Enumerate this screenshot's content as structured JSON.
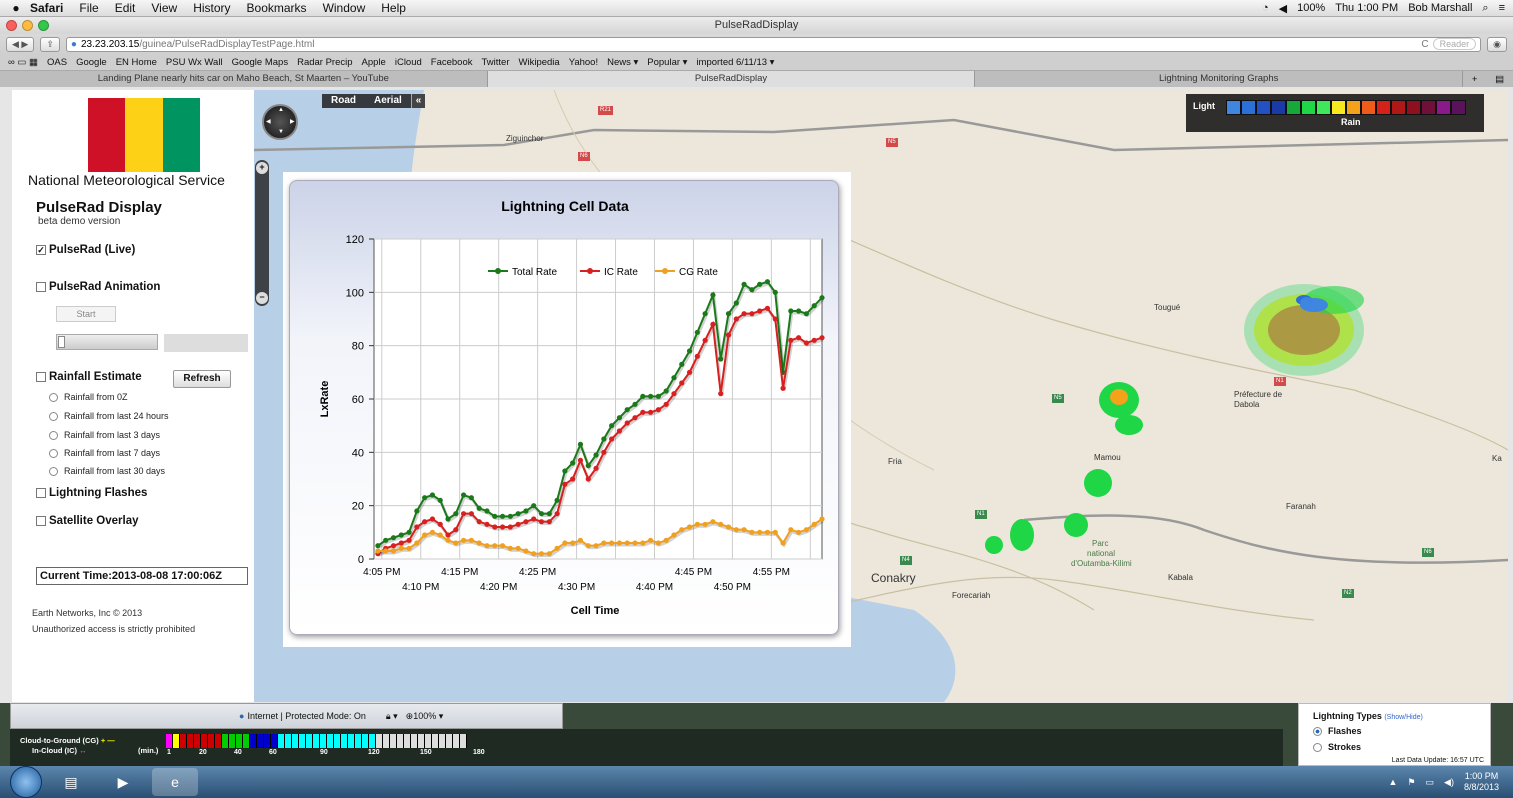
{
  "macmenu": {
    "apple": "",
    "items": [
      "Safari",
      "File",
      "Edit",
      "View",
      "History",
      "Bookmarks",
      "Window",
      "Help"
    ],
    "battery": "100%",
    "clock": "Thu 1:00 PM",
    "user": "Bob Marshall"
  },
  "browser": {
    "window_title": "PulseRadDisplay",
    "url_host": "23.23.203.15",
    "url_path": "/guinea/PulseRadDisplayTestPage.html",
    "reader": "Reader",
    "bookmarks": [
      "OAS",
      "Google",
      "EN Home",
      "PSU Wx Wall",
      "Google Maps",
      "Radar Precip",
      "Apple",
      "iCloud",
      "Facebook",
      "Twitter",
      "Wikipedia",
      "Yahoo!",
      "News ▾",
      "Popular ▾",
      "imported 6/11/13 ▾"
    ],
    "tabs": [
      "Landing Plane nearly hits car on Maho Beach, St Maarten – YouTube",
      "PulseRadDisplay",
      "Lightning Monitoring Graphs"
    ]
  },
  "sidebar": {
    "org": "National Meteorological Service",
    "title": "PulseRad Display",
    "subtitle": "beta demo version",
    "live_label": "PulseRad (Live)",
    "animation_label": "PulseRad Animation",
    "start_label": "Start",
    "rainfall_label": "Rainfall Estimate",
    "refresh_label": "Refresh",
    "rain_options": [
      "Rainfall from 0Z",
      "Rainfall from last 24 hours",
      "Rainfall from last 3 days",
      "Rainfall from last 7 days",
      "Rainfall from last 30 days"
    ],
    "lightning_label": "Lightning Flashes",
    "satellite_label": "Satellite Overlay",
    "current_time": "Current Time:2013-08-08 17:00:06Z",
    "copyright": "Earth Networks, Inc © 2013",
    "warning": "Unauthorized access is strictly prohibited",
    "flag_colors": [
      "#ce1126",
      "#fcd116",
      "#009460"
    ]
  },
  "map": {
    "road_label": "Road",
    "aerial_label": "Aerial",
    "collapse": "«",
    "legend_light": "Light",
    "legend_rain": "Rain",
    "legend_colors": [
      "#3f86e0",
      "#2b6fd8",
      "#2350c2",
      "#1a3aa8",
      "#17a83a",
      "#1ed646",
      "#3fe85a",
      "#f7e81f",
      "#f4a21a",
      "#ef5b18",
      "#d6201a",
      "#b01818",
      "#8c1020",
      "#701038",
      "#8a1a8a",
      "#5a125a"
    ],
    "places": [
      "Ziguinchor",
      "Tougué",
      "Préfecture de",
      "Dabola",
      "Mamou",
      "Fria",
      "Faranah",
      "Conakry",
      "Forecariah",
      "Kabala",
      "Parc",
      "national",
      "d'Outamba-Kilimi",
      "Ka"
    ],
    "roads": [
      "R21",
      "N6",
      "N5",
      "N5",
      "N1",
      "N1",
      "N4",
      "N6",
      "N2"
    ]
  },
  "chart_data": {
    "type": "line",
    "title": "Lightning Cell Data",
    "xlabel": "Cell Time",
    "ylabel": "LxRate",
    "ylim": [
      0,
      120
    ],
    "yticks": [
      0,
      20,
      40,
      60,
      80,
      100,
      120
    ],
    "xlim": [
      4.0,
      61.5
    ],
    "xticks_upper": [
      {
        "x": 5,
        "label": "4:05 PM"
      },
      {
        "x": 15,
        "label": "4:15 PM"
      },
      {
        "x": 25,
        "label": "4:25 PM"
      },
      {
        "x": 45,
        "label": "4:45 PM"
      },
      {
        "x": 55,
        "label": "4:55 PM"
      }
    ],
    "xticks_lower": [
      {
        "x": 10,
        "label": "4:10 PM"
      },
      {
        "x": 20,
        "label": "4:20 PM"
      },
      {
        "x": 30,
        "label": "4:30 PM"
      },
      {
        "x": 40,
        "label": "4:40 PM"
      },
      {
        "x": 50,
        "label": "4:50 PM"
      }
    ],
    "grid": true,
    "legend_placement": "top-right",
    "x": [
      4.5,
      5.5,
      6.5,
      7.5,
      8.5,
      9.5,
      10.5,
      11.5,
      12.5,
      13.5,
      14.5,
      15.5,
      16.5,
      17.5,
      18.5,
      19.5,
      20.5,
      21.5,
      22.5,
      23.5,
      24.5,
      25.5,
      26.5,
      27.5,
      28.5,
      29.5,
      30.5,
      31.5,
      32.5,
      33.5,
      34.5,
      35.5,
      36.5,
      37.5,
      38.5,
      39.5,
      40.5,
      41.5,
      42.5,
      43.5,
      44.5,
      45.5,
      46.5,
      47.5,
      48.5,
      49.5,
      50.5,
      51.5,
      52.5,
      53.5,
      54.5,
      55.5,
      56.5,
      57.5,
      58.5,
      59.5,
      60.5,
      61.5
    ],
    "series": [
      {
        "name": "Total Rate",
        "color": "#1a7a1a",
        "values": [
          5,
          7,
          8,
          9,
          10,
          18,
          23,
          24,
          22,
          15,
          17,
          24,
          23,
          19,
          18,
          16,
          16,
          16,
          17,
          18,
          20,
          17,
          17,
          22,
          33,
          36,
          43,
          35,
          39,
          45,
          50,
          53,
          56,
          58,
          61,
          61,
          61,
          63,
          68,
          73,
          78,
          85,
          92,
          99,
          75,
          92,
          96,
          103,
          101,
          103,
          104,
          100,
          70,
          93,
          93,
          92,
          95,
          98
        ]
      },
      {
        "name": "IC Rate",
        "color": "#d82020",
        "values": [
          2,
          4,
          5,
          6,
          7,
          12,
          14,
          15,
          13,
          9,
          11,
          17,
          17,
          14,
          13,
          12,
          12,
          12,
          13,
          14,
          15,
          14,
          14,
          17,
          28,
          30,
          37,
          30,
          34,
          40,
          45,
          48,
          51,
          53,
          55,
          55,
          56,
          58,
          62,
          66,
          70,
          76,
          82,
          88,
          62,
          84,
          90,
          92,
          92,
          93,
          94,
          90,
          64,
          82,
          83,
          81,
          82,
          83
        ]
      },
      {
        "name": "CG Rate",
        "color": "#f0a020",
        "values": [
          3,
          3,
          3,
          4,
          4,
          6,
          9,
          10,
          9,
          7,
          6,
          7,
          7,
          6,
          5,
          5,
          5,
          4,
          4,
          3,
          2,
          2,
          2,
          4,
          6,
          6,
          7,
          5,
          5,
          6,
          6,
          6,
          6,
          6,
          6,
          7,
          6,
          7,
          9,
          11,
          12,
          13,
          13,
          14,
          13,
          12,
          11,
          11,
          10,
          10,
          10,
          10,
          6,
          11,
          10,
          11,
          13,
          15
        ]
      }
    ]
  },
  "ie_status": {
    "zone": "Internet | Protected Mode: On",
    "zoom": "100%"
  },
  "lightning_bar": {
    "cg_label": "Cloud-to-Ground (CG)",
    "ic_label": "In-Cloud (IC)",
    "minutes_label": "(min.)",
    "ticks": [
      "1",
      "20",
      "40",
      "60",
      "90",
      "120",
      "150",
      "180"
    ],
    "scale_colors": [
      "#ff00ff",
      "#ffff00",
      "#cc0000",
      "#cc0000",
      "#cc0000",
      "#cc0000",
      "#cc0000",
      "#cc0000",
      "#00cc00",
      "#00cc00",
      "#00cc00",
      "#00cc00",
      "#0000cc",
      "#0000cc",
      "#0000cc",
      "#0000cc",
      "#00ffff",
      "#00ffff",
      "#00ffff",
      "#00ffff",
      "#00ffff",
      "#00ffff",
      "#00ffff",
      "#00ffff",
      "#00ffff",
      "#00ffff",
      "#00ffff",
      "#00ffff",
      "#00ffff",
      "#00ffff",
      "#dddddd",
      "#dddddd",
      "#dddddd",
      "#dddddd",
      "#dddddd",
      "#dddddd",
      "#dddddd",
      "#dddddd",
      "#dddddd",
      "#dddddd",
      "#dddddd",
      "#dddddd",
      "#dddddd"
    ]
  },
  "lightning_types": {
    "title": "Lightning Types",
    "show_hide": "(Show/Hide)",
    "flashes": "Flashes",
    "strokes": "Strokes",
    "last_update": "Last Data Update: 16:57 UTC"
  },
  "taskbar": {
    "time": "1:00 PM",
    "date": "8/8/2013"
  }
}
